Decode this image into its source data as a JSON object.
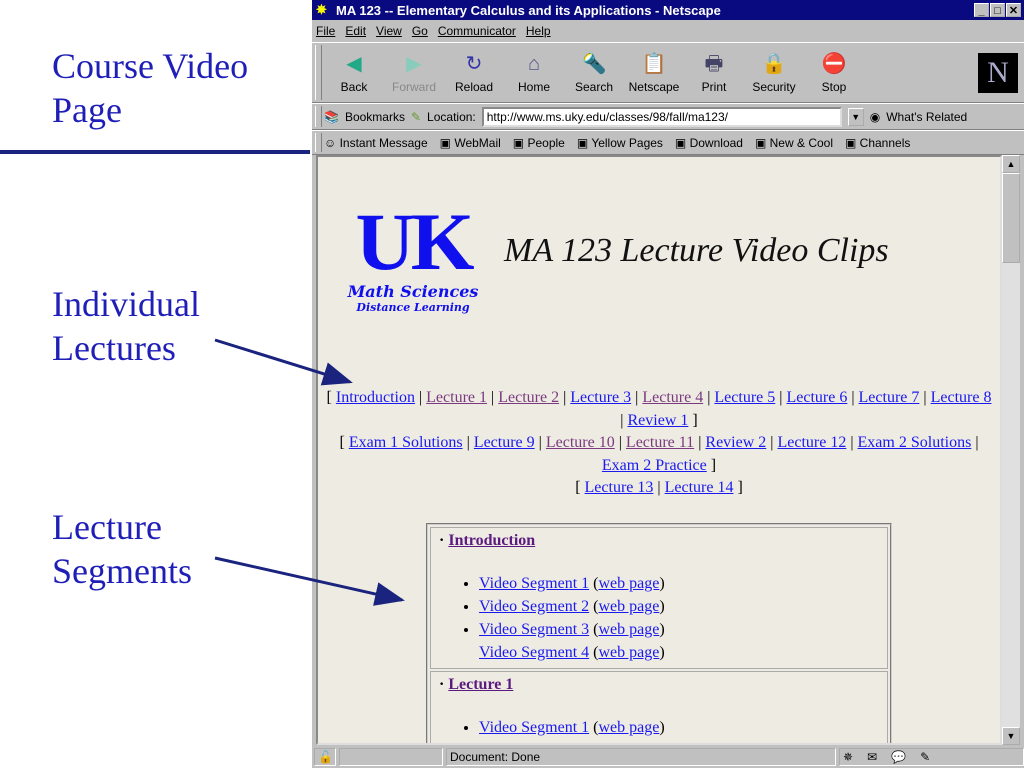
{
  "slide": {
    "title_lines": [
      "Course Video",
      "Page"
    ],
    "label1_lines": [
      "Individual",
      "Lectures"
    ],
    "label2_lines": [
      "Lecture",
      "Segments"
    ],
    "accent": "#1f1fb8"
  },
  "window": {
    "title": "MA 123 -- Elementary Calculus and its Applications - Netscape"
  },
  "menu": [
    "File",
    "Edit",
    "View",
    "Go",
    "Communicator",
    "Help"
  ],
  "toolbar": [
    {
      "label": "Back",
      "icon": "back-icon"
    },
    {
      "label": "Forward",
      "icon": "forward-icon"
    },
    {
      "label": "Reload",
      "icon": "reload-icon"
    },
    {
      "label": "Home",
      "icon": "home-icon"
    },
    {
      "label": "Search",
      "icon": "search-icon"
    },
    {
      "label": "Netscape",
      "icon": "my-netscape-icon"
    },
    {
      "label": "Print",
      "icon": "print-icon"
    },
    {
      "label": "Security",
      "icon": "security-icon"
    },
    {
      "label": "Stop",
      "icon": "stop-icon"
    }
  ],
  "location": {
    "bookmarks": "Bookmarks",
    "label": "Location:",
    "url": "http://www.ms.uky.edu/classes/98/fall/ma123/",
    "related": "What's Related"
  },
  "personal": [
    "Instant Message",
    "WebMail",
    "People",
    "Yellow Pages",
    "Download",
    "New & Cool",
    "Channels"
  ],
  "page": {
    "logo": {
      "uk": "UK",
      "line1": "Math Sciences",
      "line2": "Distance Learning"
    },
    "heading": "MA 123 Lecture Video Clips",
    "links": [
      [
        "Introduction",
        "Lecture 1",
        "Lecture 2",
        "Lecture 3",
        "Lecture 4",
        "Lecture 5",
        "Lecture 6",
        "Lecture 7",
        "Lecture 8",
        "Review 1"
      ],
      [
        "Exam 1 Solutions",
        "Lecture 9",
        "Lecture 10",
        "Lecture 11",
        "Review 2",
        "Lecture 12",
        "Exam 2 Solutions",
        "Exam 2 Practice"
      ],
      [
        "Lecture 13",
        "Lecture 14"
      ]
    ],
    "sections": [
      {
        "title": "Introduction",
        "segments": [
          "Video Segment 1",
          "Video Segment 2",
          "Video Segment 3",
          "Video Segment 4"
        ]
      },
      {
        "title": "Lecture 1",
        "segments": [
          "Video Segment 1"
        ]
      }
    ],
    "web_page": "web page"
  },
  "status": {
    "text": "Document: Done"
  }
}
